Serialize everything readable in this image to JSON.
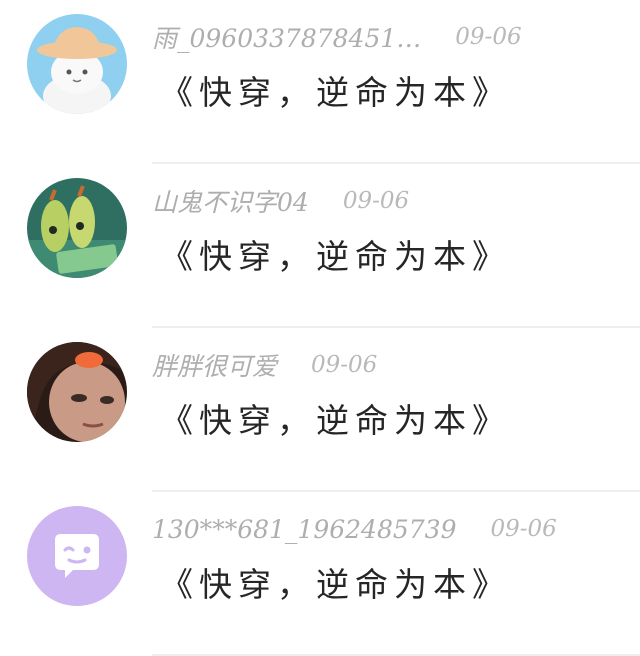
{
  "comments": [
    {
      "username": "雨_0960337878451…",
      "time": "09-06",
      "text": "《快穿，逆命为本》",
      "avatar": "bucket-hat-bear-avatar"
    },
    {
      "username": "山鬼不识字04",
      "time": "09-06",
      "text": "《快穿，逆命为本》",
      "avatar": "cartoon-pickle-avatar"
    },
    {
      "username": "胖胖很可爱",
      "time": "09-06",
      "text": "《快穿，逆命为本》",
      "avatar": "person-photo-avatar"
    },
    {
      "username": "130***681_1962485739",
      "time": "09-06",
      "text": "《快穿，逆命为本》",
      "avatar": "default-chat-bubble-avatar"
    }
  ],
  "colors": {
    "username": "#aeaeae",
    "time": "#b9b9b9",
    "text": "#262626",
    "divider": "#eeeeee",
    "default_avatar_bg": "#cdb6f1"
  }
}
